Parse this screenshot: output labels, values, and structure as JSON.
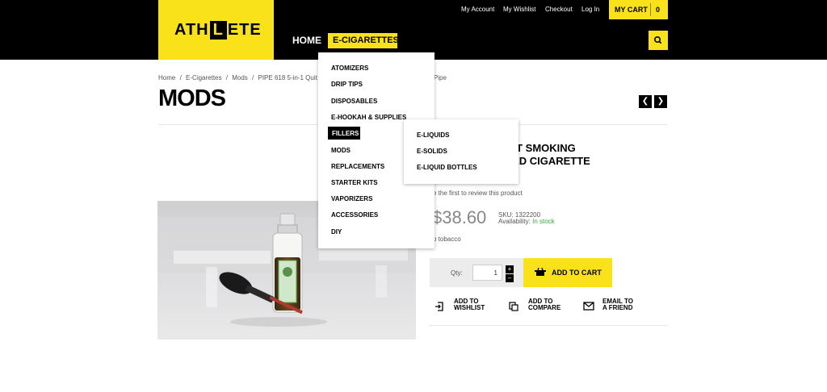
{
  "brand": {
    "logo_pre": "ATH",
    "logo_box": "L",
    "logo_post": "ETE"
  },
  "topbar": {
    "links": [
      "My Account",
      "My Wishlist",
      "Checkout",
      "Log In"
    ],
    "cart_label": "MY CART",
    "cart_count": "0"
  },
  "nav": {
    "home": "HOME",
    "ecig": "E-CIGARETTES"
  },
  "breadcrumb": {
    "items": [
      "Home",
      "E-Cigarettes",
      "Mods",
      "PIPE 618 5-in-1 Quit S"
    ],
    "separator": "/",
    "hidden_tail": "king Pipe"
  },
  "page": {
    "title": "MODS"
  },
  "dropdown": {
    "items": [
      "ATOMIZERS",
      "DRIP TIPS",
      "DISPOSABLES",
      "E-HOOKAH & SUPPLIES",
      "FILLERS",
      "MODS",
      "REPLACEMENTS",
      "STARTER KITS",
      "VAPORIZERS",
      "ACCESSORIES",
      "DIY"
    ],
    "active": "FILLERS"
  },
  "submenu": {
    "items": [
      "E-LIQUIDS",
      "E-SOLIDS",
      "E-LIQUID BOTTLES"
    ]
  },
  "product": {
    "title_line1": "QUIT SMOKING",
    "title_line2": "ERED CIGARETTE",
    "review_text": "e the first to review this product",
    "price": "$38.60",
    "sku_label": "SKU:",
    "sku": "1322200",
    "availability_label": "Availability:",
    "availability": "In stock",
    "short_desc": "o tobacco",
    "qty_label": "Qty:",
    "qty_value": "1",
    "add_to_cart": "ADD TO CART",
    "wishlist_line1": "ADD TO",
    "wishlist_line2": "WISHLIST",
    "compare_line1": "ADD TO",
    "compare_line2": "COMPARE",
    "friend_line1": "EMAIL TO",
    "friend_line2": "A FRIEND"
  },
  "colors": {
    "accent": "#f9e21a",
    "dark": "#000000",
    "instock": "#3aa63a"
  },
  "icons": [
    "search-icon",
    "cart-icon",
    "wishlist-icon",
    "compare-icon",
    "email-icon",
    "prev-arrow-icon",
    "next-arrow-icon",
    "plus-icon",
    "minus-icon"
  ]
}
